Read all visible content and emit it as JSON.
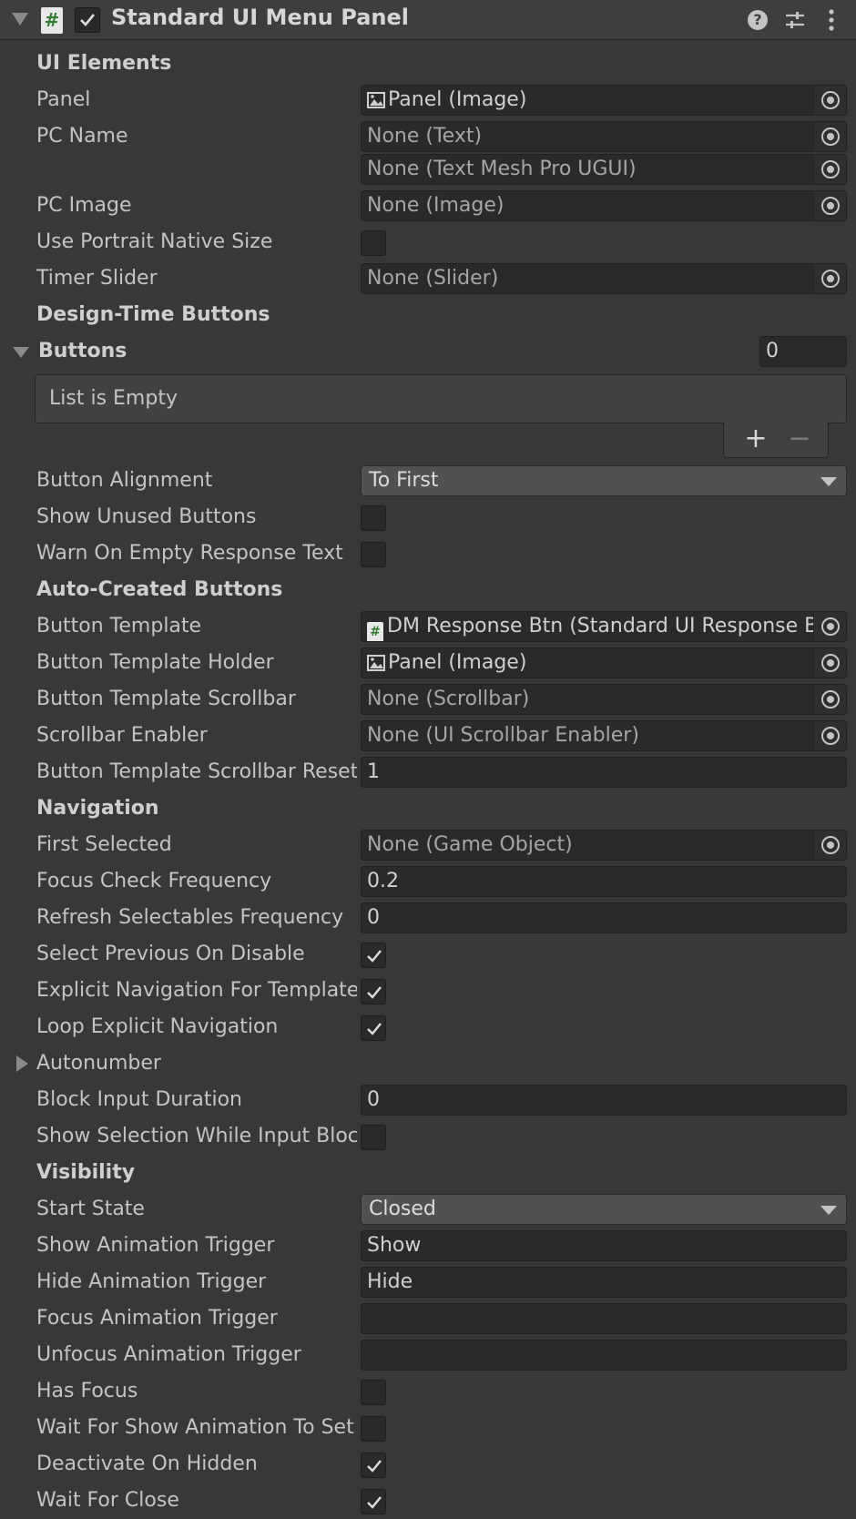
{
  "header": {
    "title": "Standard UI Menu Panel",
    "script_icon_glyph": "#",
    "help_glyph": "?"
  },
  "sections": {
    "ui_elements": "UI Elements",
    "design_time_buttons": "Design-Time Buttons",
    "auto_created_buttons": "Auto-Created Buttons",
    "navigation": "Navigation",
    "visibility": "Visibility"
  },
  "ui_elements": {
    "panel": {
      "label": "Panel",
      "value": "Panel (Image)"
    },
    "pc_name": {
      "label": "PC Name",
      "value": "None (Text)",
      "value2": "None (Text Mesh Pro UGUI)"
    },
    "pc_image": {
      "label": "PC Image",
      "value": "None (Image)"
    },
    "use_portrait_native_size": {
      "label": "Use Portrait Native Size",
      "checked": false
    },
    "timer_slider": {
      "label": "Timer Slider",
      "value": "None (Slider)"
    }
  },
  "design_time": {
    "buttons": {
      "label": "Buttons",
      "count": "0",
      "empty_text": "List is Empty",
      "add": "+",
      "remove": "−"
    },
    "button_alignment": {
      "label": "Button Alignment",
      "value": "To First"
    },
    "show_unused_buttons": {
      "label": "Show Unused Buttons",
      "checked": false
    },
    "warn_on_empty_response_text": {
      "label": "Warn On Empty Response Text",
      "checked": false
    }
  },
  "auto_created": {
    "button_template": {
      "label": "Button Template",
      "value": "DM Response Btn (Standard UI Response Button)",
      "glyph": "#"
    },
    "button_template_holder": {
      "label": "Button Template Holder",
      "value": "Panel (Image)"
    },
    "button_template_scrollbar": {
      "label": "Button Template Scrollbar",
      "value": "None (Scrollbar)"
    },
    "scrollbar_enabler": {
      "label": "Scrollbar Enabler",
      "value": "None (UI Scrollbar Enabler)"
    },
    "button_template_scrollbar_reset": {
      "label": "Button Template Scrollbar Reset Value",
      "value": "1"
    }
  },
  "navigation": {
    "first_selected": {
      "label": "First Selected",
      "value": "None (Game Object)"
    },
    "focus_check_frequency": {
      "label": "Focus Check Frequency",
      "value": "0.2"
    },
    "refresh_selectables_frequency": {
      "label": "Refresh Selectables Frequency",
      "value": "0"
    },
    "select_previous_on_disable": {
      "label": "Select Previous On Disable",
      "checked": true
    },
    "explicit_navigation_for_template": {
      "label": "Explicit Navigation For Template Buttons",
      "checked": true
    },
    "loop_explicit_navigation": {
      "label": "Loop Explicit Navigation",
      "checked": true
    },
    "autonumber": {
      "label": "Autonumber"
    },
    "block_input_duration": {
      "label": "Block Input Duration",
      "value": "0"
    },
    "show_selection_while_input_blocked": {
      "label": "Show Selection While Input Blocked",
      "checked": false
    }
  },
  "visibility": {
    "start_state": {
      "label": "Start State",
      "value": "Closed"
    },
    "show_animation_trigger": {
      "label": "Show Animation Trigger",
      "value": "Show"
    },
    "hide_animation_trigger": {
      "label": "Hide Animation Trigger",
      "value": "Hide"
    },
    "focus_animation_trigger": {
      "label": "Focus Animation Trigger",
      "value": ""
    },
    "unfocus_animation_trigger": {
      "label": "Unfocus Animation Trigger",
      "value": ""
    },
    "has_focus": {
      "label": "Has Focus",
      "checked": false
    },
    "wait_for_show_animation": {
      "label": "Wait For Show Animation To Set Open",
      "checked": false
    },
    "deactivate_on_hidden": {
      "label": "Deactivate On Hidden",
      "checked": true
    },
    "wait_for_close": {
      "label": "Wait For Close",
      "checked": true
    }
  }
}
